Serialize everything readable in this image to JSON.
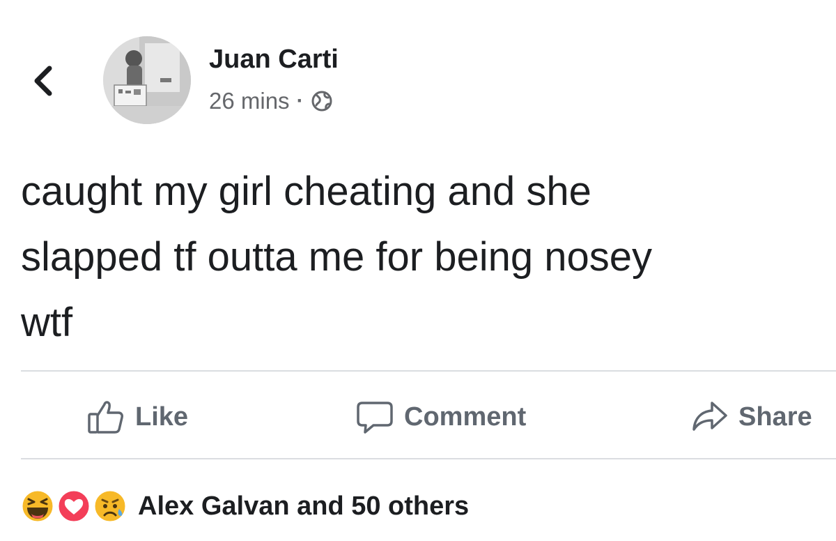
{
  "post": {
    "author": "Juan Carti",
    "timestamp": "26 mins",
    "separator": "·",
    "privacy_icon": "globe-icon",
    "text": "caught my girl cheating and she\nslapped tf outta me for being nosey\nwtf"
  },
  "actions": {
    "like_label": "Like",
    "comment_label": "Comment",
    "share_label": "Share"
  },
  "reactions": {
    "icons": [
      "haha-icon",
      "love-icon",
      "sad-icon"
    ],
    "summary": "Alex Galvan and 50 others"
  },
  "colors": {
    "text_primary": "#1c1e21",
    "text_secondary": "#65676b",
    "action_text": "#606770",
    "divider": "#dadde1",
    "haha_yellow": "#f7b928",
    "love_red": "#f33e58"
  }
}
